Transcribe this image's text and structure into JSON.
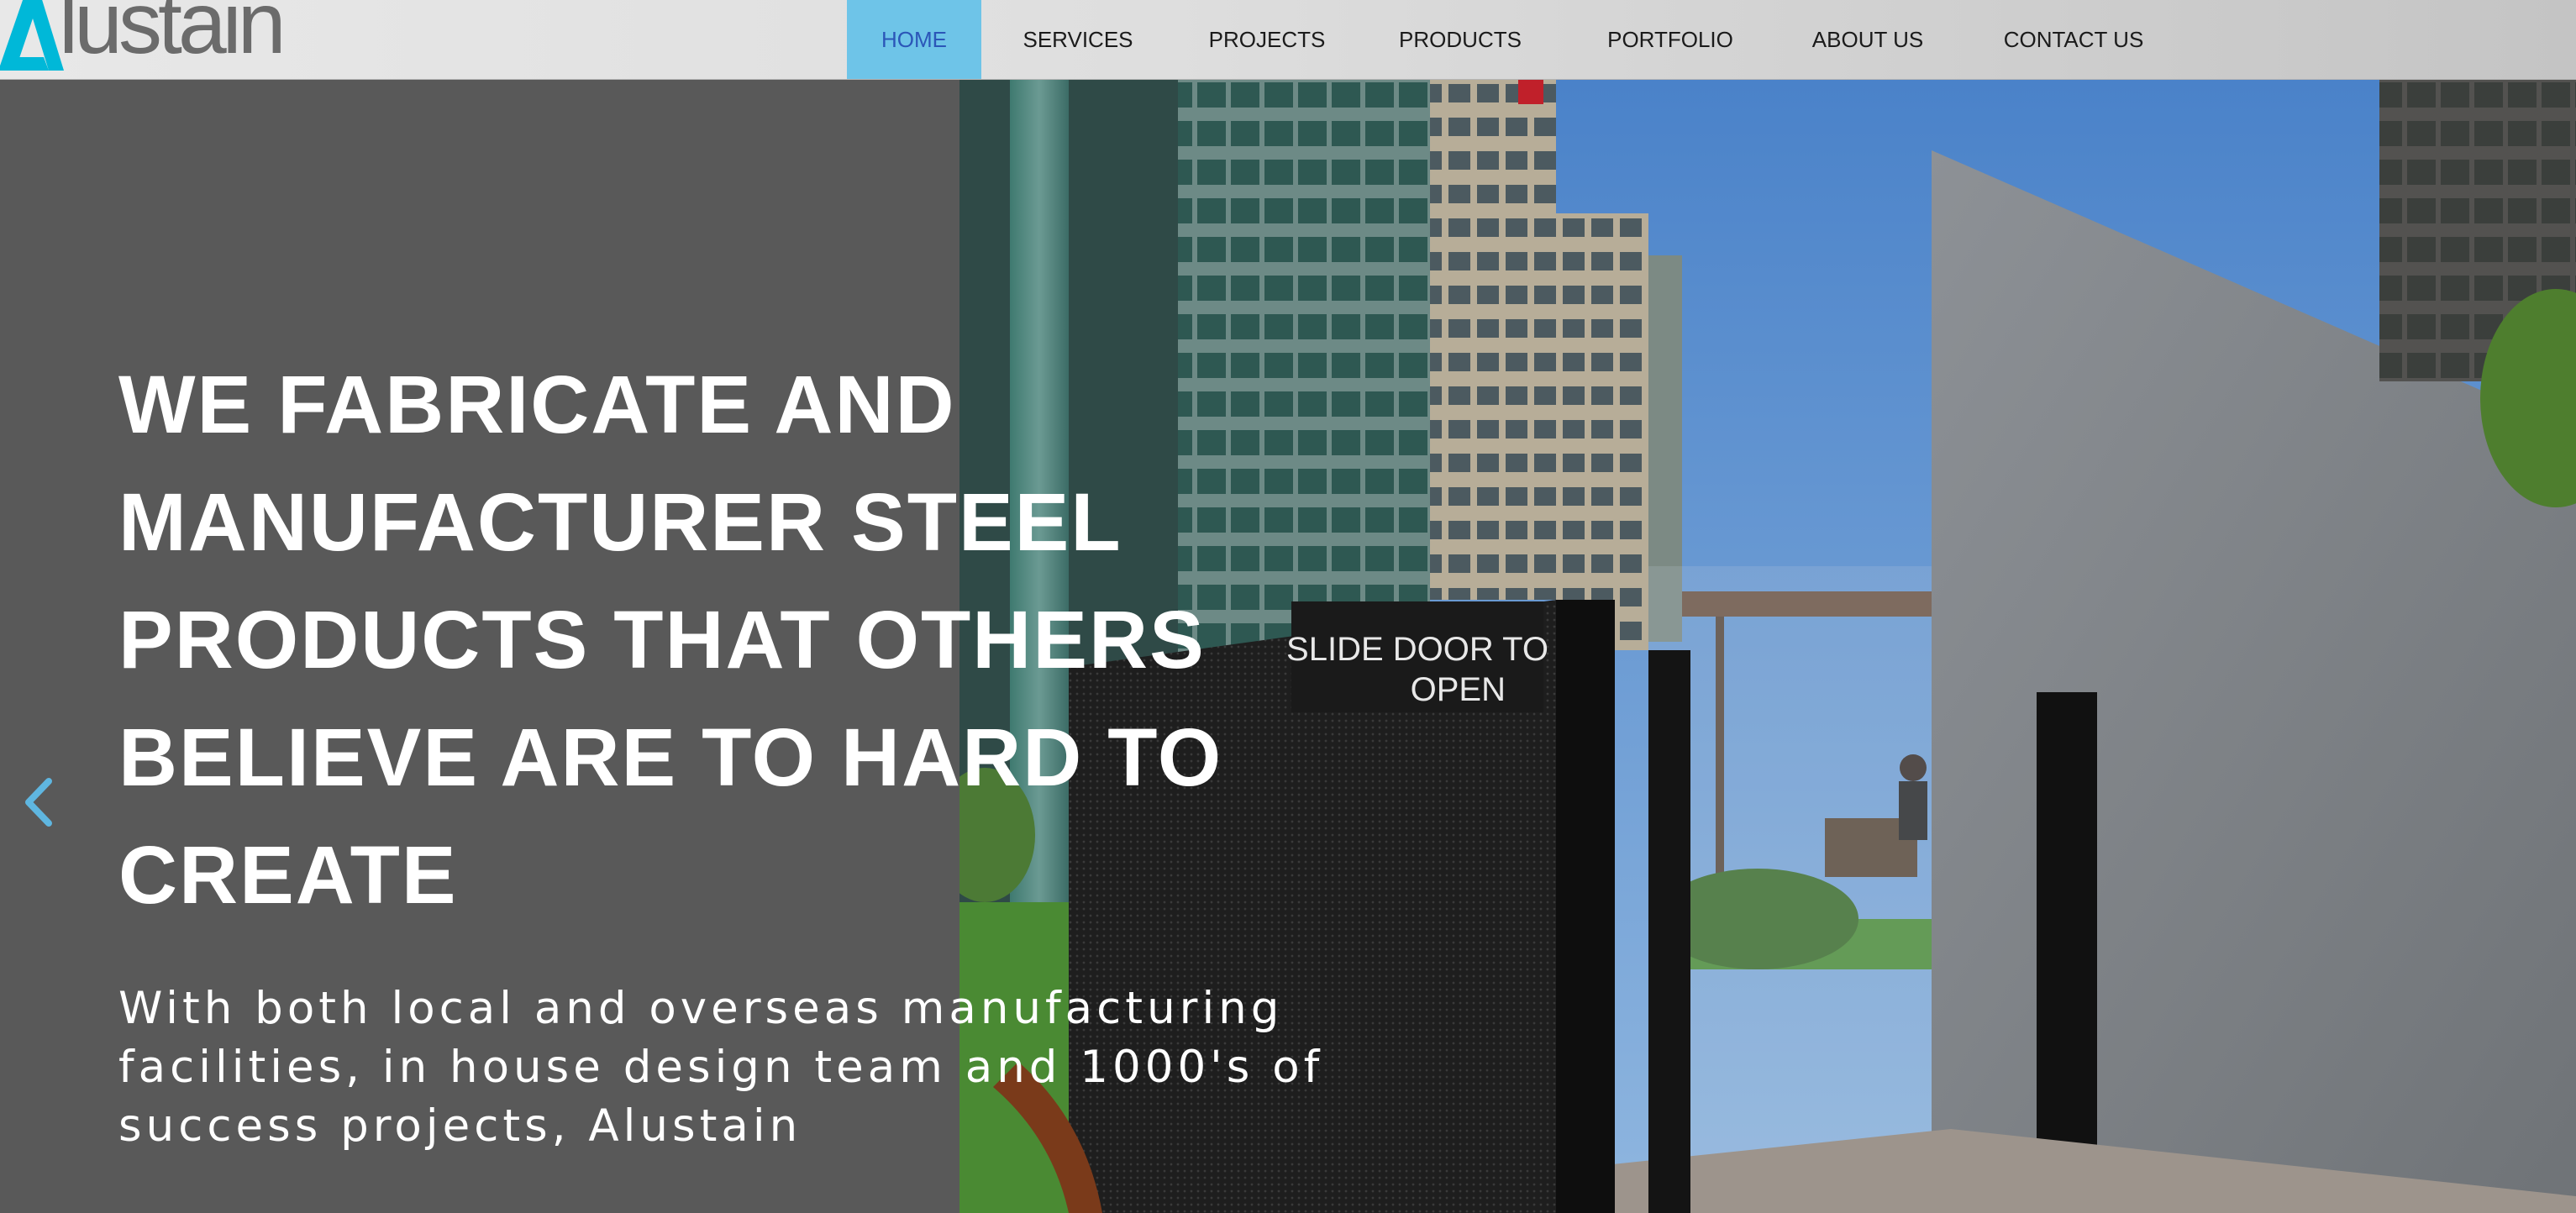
{
  "brand": {
    "logo_text": "lustain",
    "logo_mark": "A-triangle-icon",
    "accent_color": "#00b8d8"
  },
  "nav": {
    "items": [
      {
        "label": "HOME",
        "active": true
      },
      {
        "label": "SERVICES",
        "active": false
      },
      {
        "label": "PROJECTS",
        "active": false
      },
      {
        "label": "PRODUCTS",
        "active": false
      },
      {
        "label": "PORTFOLIO",
        "active": false
      },
      {
        "label": "ABOUT US",
        "active": false
      },
      {
        "label": "CONTACT US",
        "active": false
      }
    ],
    "active_bg": "#6ec4e8",
    "active_text": "#2b56b8"
  },
  "hero": {
    "headline": "WE FABRICATE AND MANUFACTURER STEEL PRODUCTS THAT OTHERS BELIEVE ARE TO HARD TO CREATE",
    "subtext": "With both local and overseas manufacturing facilities, in house design team and 1000's of success projects, Alustain",
    "prev_icon": "chevron-left-icon",
    "photo_sign_line1": "SLIDE DOOR TO",
    "photo_sign_line2": "OPEN"
  }
}
